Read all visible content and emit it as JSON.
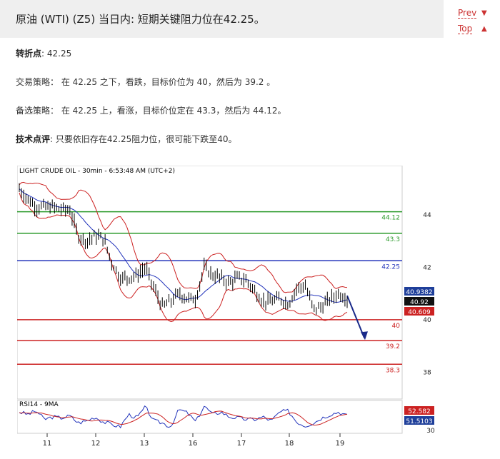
{
  "header": {
    "title": "原油 (WTI) (Z5) 当日内: 短期关键阻力位在42.25。",
    "prev_label": "Prev",
    "top_label": "Top",
    "prev_arrow": "▼",
    "top_arrow": "▲"
  },
  "body": {
    "pivot_label": "转折点",
    "pivot_value": ": 42.25",
    "strategy_text": "交易策略： 在 42.25 之下，看跌，目标价位为 40，然后为 39.2 。",
    "alt_text": "备选策略： 在 42.25 上，看涨，目标价位定在 43.3，然后为 44.12。",
    "comment_label": "技术点评",
    "comment_text": ": 只要依旧存在42.25阻力位，很可能下跌至40。"
  },
  "chart_data": {
    "type": "candlestick",
    "title": "LIGHT CRUDE OIL - 30min - 6:53:48 AM (UTC+2)",
    "x_ticks": [
      "11",
      "12",
      "13",
      "16",
      "17",
      "18",
      "19"
    ],
    "y_ticks": [
      44,
      42,
      40,
      38
    ],
    "ylim": [
      37.0,
      45.5
    ],
    "levels": [
      {
        "value": 44.12,
        "label": "44.12",
        "color": "#2a9a2a"
      },
      {
        "value": 43.3,
        "label": "43.3",
        "color": "#2a9a2a"
      },
      {
        "value": 42.25,
        "label": "42.25",
        "color": "#2233bb"
      },
      {
        "value": 40,
        "label": "40",
        "color": "#cc2222"
      },
      {
        "value": 39.2,
        "label": "39.2",
        "color": "#cc2222"
      },
      {
        "value": 38.3,
        "label": "38.3",
        "color": "#cc2222"
      }
    ],
    "price_tags": [
      {
        "value": 40.9382,
        "label": "40.9382",
        "bg": "#1f3f9a"
      },
      {
        "value": 40.92,
        "label": "40.92",
        "bg": "#111111"
      },
      {
        "value": 40.609,
        "label": "40.609",
        "bg": "#cc2222"
      }
    ],
    "price_path": [
      45.0,
      44.6,
      44.3,
      44.3,
      44.3,
      44.2,
      44.2,
      43.2,
      43.0,
      43.2,
      43.1,
      42.2,
      41.6,
      41.6,
      41.7,
      42.0,
      41.2,
      40.5,
      40.7,
      41.0,
      40.8,
      40.8,
      42.0,
      41.7,
      41.6,
      41.4,
      41.6,
      41.5,
      41.1,
      40.7,
      40.7,
      40.8,
      40.6,
      41.2,
      41.3,
      40.4,
      40.5,
      40.8,
      41.0,
      40.8
    ],
    "forecast": {
      "from": 40.92,
      "to": 39.2
    },
    "rsi": {
      "title": "RSI14 - 9MA",
      "y_ticks": [
        30
      ],
      "tags": [
        {
          "label": "52.582",
          "bg": "#cc2222"
        },
        {
          "label": "51.5103",
          "bg": "#1f3f9a"
        }
      ],
      "values": [
        60,
        55,
        62,
        45,
        50,
        48,
        52,
        38,
        42,
        50,
        40,
        35,
        30,
        55,
        48,
        70,
        42,
        38,
        30,
        65,
        58,
        40,
        72,
        55,
        60,
        50,
        48,
        45,
        45,
        50,
        42,
        60,
        62,
        40,
        32,
        38,
        48,
        55,
        60,
        52
      ]
    }
  }
}
